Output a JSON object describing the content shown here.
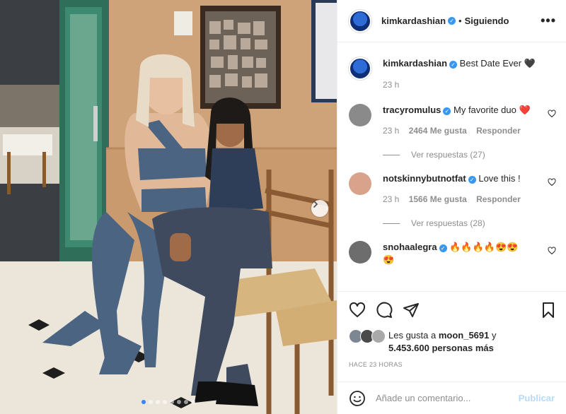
{
  "post": {
    "author": "kimkardashian",
    "follow_status": "Siguiendo",
    "separator": "•",
    "more_glyph": "•••",
    "caption": "Best Date Ever",
    "caption_emoji": "🖤",
    "caption_age": "23 h",
    "carousel": {
      "slides": 8,
      "active_index": 0
    }
  },
  "comments": [
    {
      "user": "tracyromulus",
      "text": "My favorite duo",
      "emoji": "❤️",
      "age": "23 h",
      "likes": "2464 Me gusta",
      "reply_label": "Responder",
      "view_replies": "Ver respuestas (27)",
      "avatar_color": "#8a8a8a"
    },
    {
      "user": "notskinnybutnotfat",
      "text": "Love this !",
      "emoji": "",
      "age": "23 h",
      "likes": "1566 Me gusta",
      "reply_label": "Responder",
      "view_replies": "Ver respuestas (28)",
      "avatar_color": "#d9a28b"
    },
    {
      "user": "snohaalegra",
      "text": "",
      "emoji": "🔥🔥🔥🔥😍😍",
      "emoji2": "😍",
      "avatar_color": "#6d6d6d"
    }
  ],
  "likes": {
    "prefix": "Les gusta a ",
    "user": "moon_5691",
    "connector": " y",
    "count_text": "5.453.600 personas más"
  },
  "timestamp": "HACE 23 HORAS",
  "comment_input": {
    "placeholder": "Añade un comentario...",
    "publish_label": "Publicar"
  },
  "colors": {
    "verified": "#3897f0",
    "heart_red": "#ed4956",
    "publish_disabled": "#b3dbff",
    "accent_dot": "#3b82f6"
  },
  "icons": {
    "like": "heart-icon",
    "comment": "comment-icon",
    "share": "share-icon",
    "save": "bookmark-icon",
    "emoji": "smiley-icon",
    "next": "chevron-right-icon"
  }
}
